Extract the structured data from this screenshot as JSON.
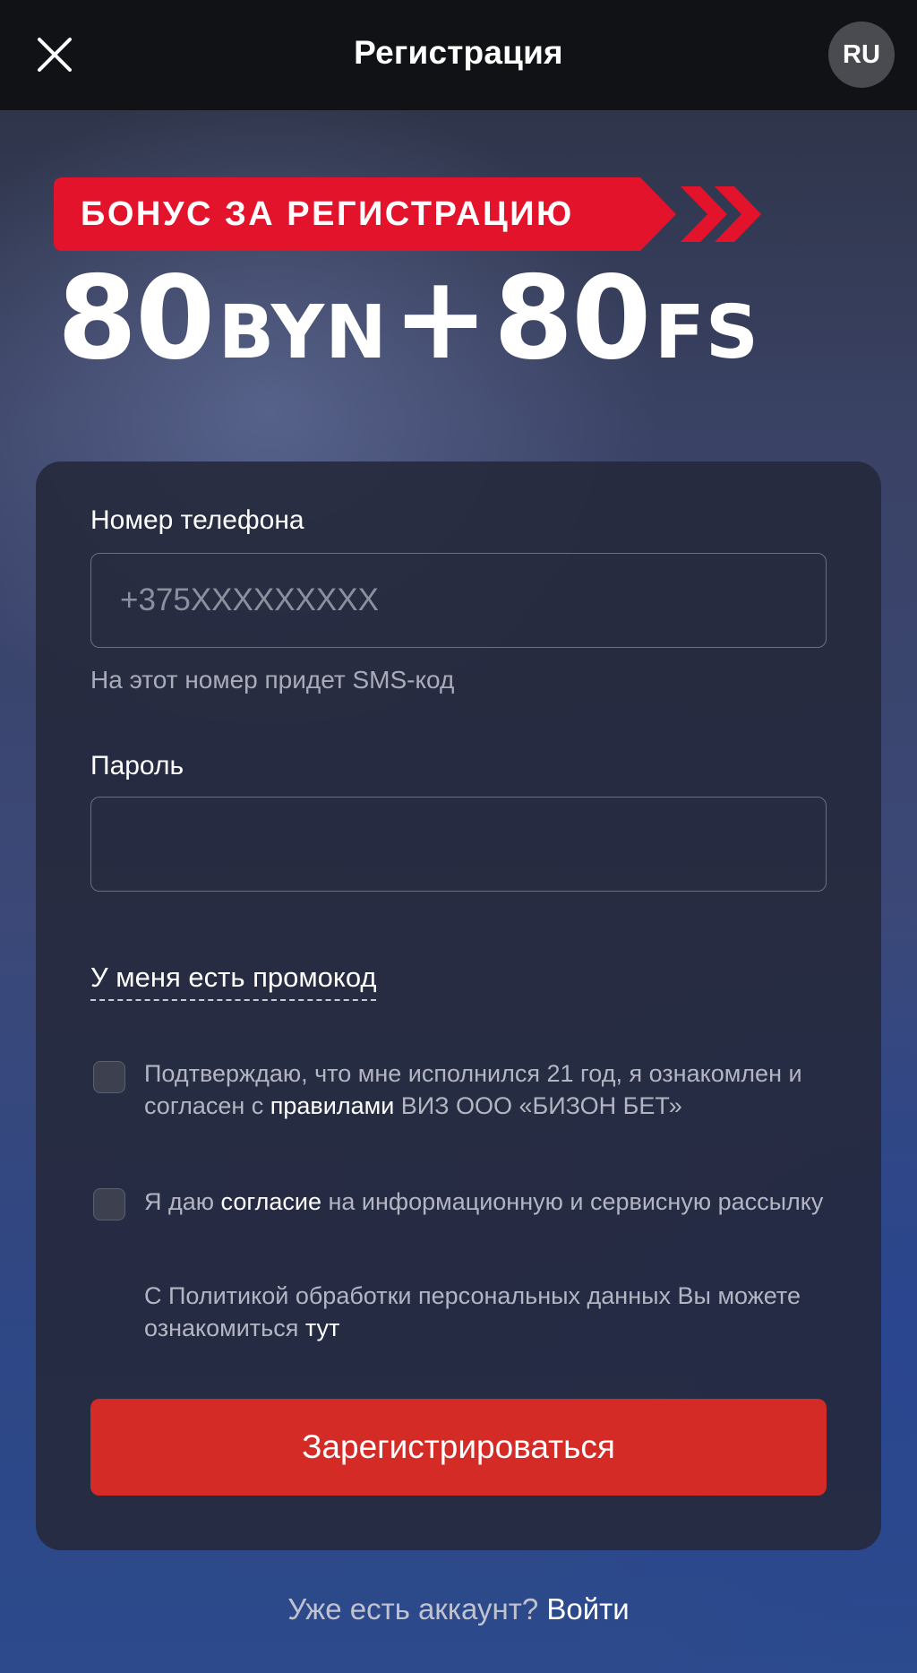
{
  "header": {
    "title": "Регистрация",
    "language": "RU"
  },
  "bonus": {
    "ribbon_text": "БОНУС ЗА РЕГИСТРАЦИЮ",
    "amount_money": "80",
    "currency": "BYN",
    "plus": "+",
    "amount_spins": "80",
    "spins_unit": "FS"
  },
  "form": {
    "phone_label": "Номер телефона",
    "phone_placeholder": "+375XXXXXXXXX",
    "phone_hint": "На этот номер придет SMS-код",
    "password_label": "Пароль",
    "password_value": "",
    "promo_link": "У меня есть промокод",
    "terms": {
      "before": "Подтверждаю, что мне исполнился 21 год, я ознакомлен и согласен с ",
      "link": "правилами",
      "after": " ВИЗ ООО «БИЗОН БЕТ»"
    },
    "consent": {
      "before": "Я даю ",
      "link": "согласие",
      "after": " на информационную и сервисную рассылку"
    },
    "policy": {
      "before": "С Политикой обработки персональных данных Вы можете ознакомиться ",
      "link": "тут"
    },
    "submit_label": "Зарегистрироваться"
  },
  "footer": {
    "question": "Уже есть аккаунт?",
    "login_link": "Войти"
  },
  "colors": {
    "accent_red": "#d52b27",
    "ribbon_red": "#e3132b",
    "topbar": "#111216"
  },
  "icons": {
    "close": "close-icon",
    "ribbon_arrows": "double-chevron-right-icon"
  }
}
